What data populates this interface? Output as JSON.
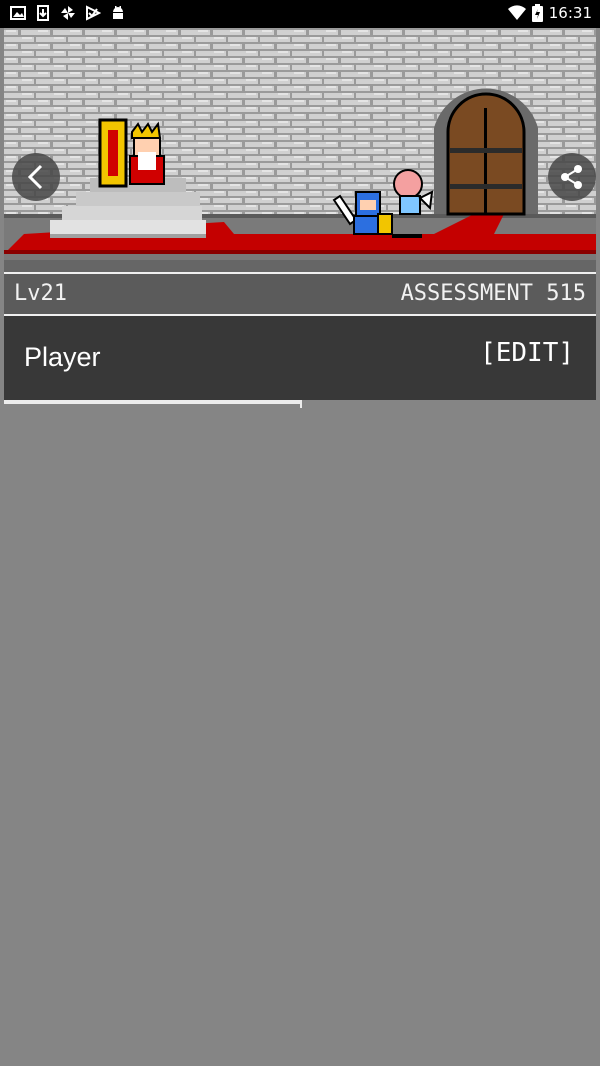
{
  "status_bar": {
    "time": "16:31",
    "left_icons": [
      "image-icon",
      "download-icon",
      "pinwheel-icon",
      "check-arrow-icon",
      "android-icon"
    ],
    "right_icons": [
      "wifi-icon",
      "battery-charging-icon"
    ]
  },
  "scene": {
    "description_icons": [
      "king-sprite",
      "throne-sprite",
      "hero-knight-sprite",
      "fairy-sprite",
      "castle-door",
      "stairs"
    ]
  },
  "hud": {
    "level": "Lv21",
    "assessment": "ASSESSMENT 515"
  },
  "player": {
    "name": "Player",
    "edit_label": "[EDIT]"
  },
  "colors": {
    "carpet": "#c00000",
    "hud_bg": "#5b5b5b",
    "name_bg": "#383838",
    "body_bg": "#858585"
  }
}
